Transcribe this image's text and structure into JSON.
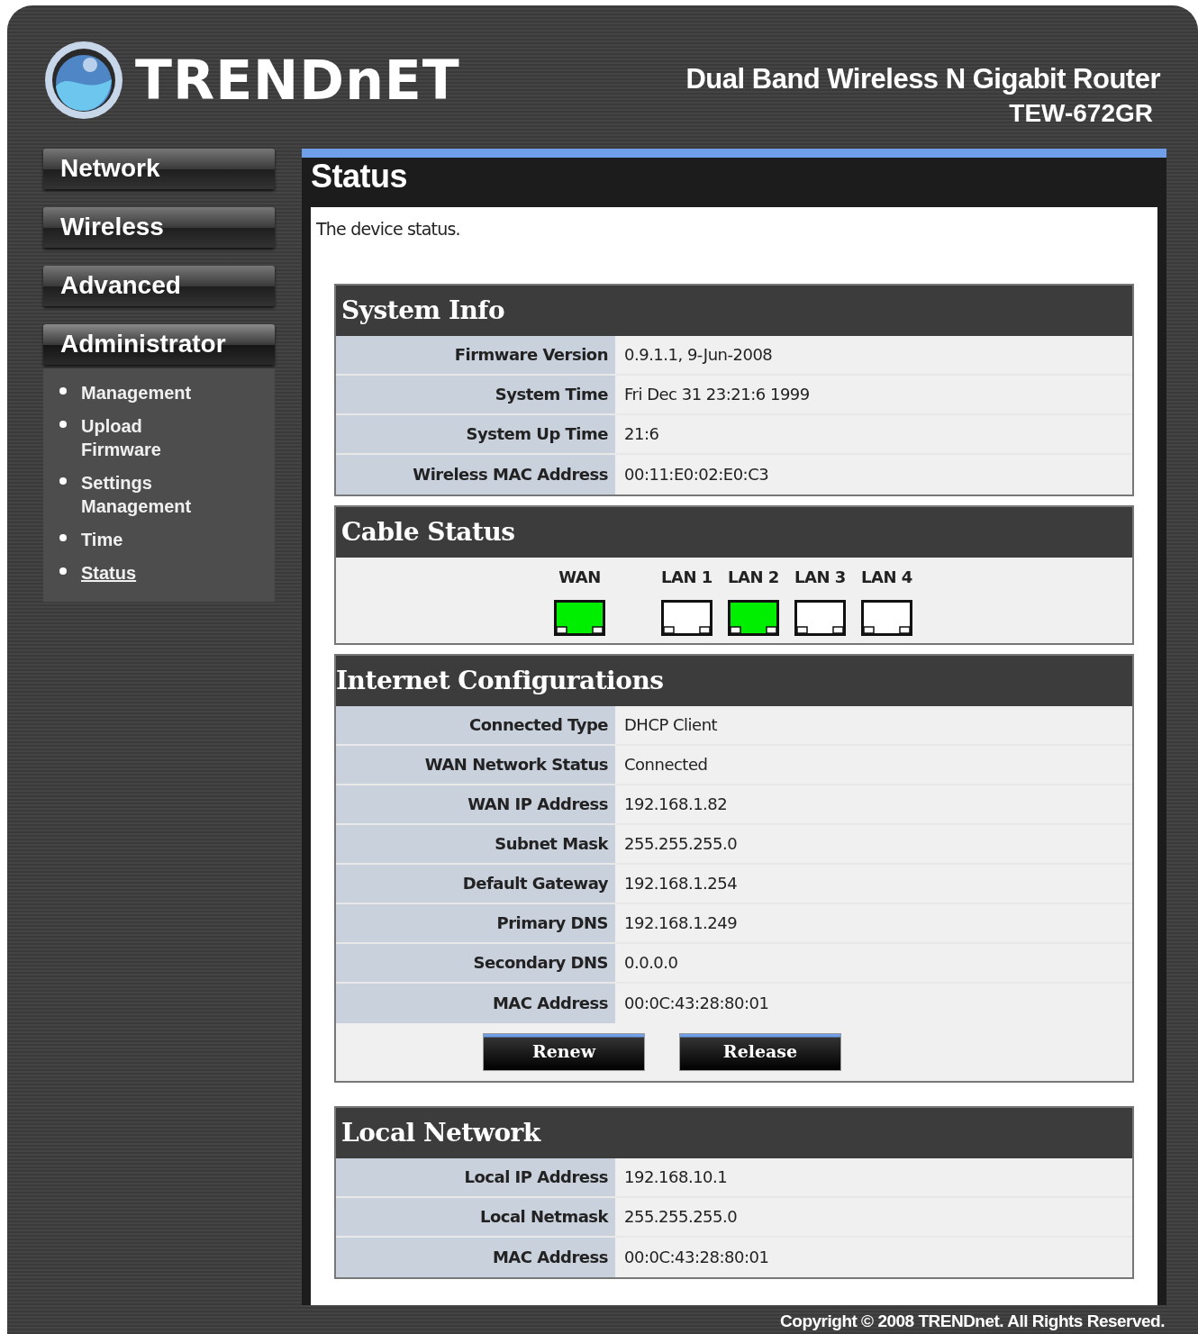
{
  "header": {
    "logo": "TRENDnET",
    "product": "Dual Band Wireless N Gigabit Router",
    "model": "TEW-672GR"
  },
  "sidebar": {
    "menus": [
      {
        "label": "Network",
        "expanded": false
      },
      {
        "label": "Wireless",
        "expanded": false
      },
      {
        "label": "Advanced",
        "expanded": false
      },
      {
        "label": "Administrator",
        "expanded": true,
        "items": [
          {
            "label": "Management",
            "selected": false
          },
          {
            "label": "Upload Firmware",
            "selected": false
          },
          {
            "label": "Settings Management",
            "selected": false
          },
          {
            "label": "Time",
            "selected": false
          },
          {
            "label": "Status",
            "selected": true
          }
        ]
      }
    ]
  },
  "page": {
    "title": "Status",
    "description": "The device status."
  },
  "system_info": {
    "title": "System Info",
    "rows": [
      {
        "label": "Firmware Version",
        "value": "0.9.1.1, 9-Jun-2008"
      },
      {
        "label": "System Time",
        "value": "Fri Dec 31 23:21:6 1999"
      },
      {
        "label": "System Up Time",
        "value": "21:6"
      },
      {
        "label": "Wireless MAC Address",
        "value": "00:11:E0:02:E0:C3"
      }
    ]
  },
  "cable_status": {
    "title": "Cable Status",
    "ports": [
      {
        "label": "WAN",
        "connected": true
      },
      {
        "label": "LAN 1",
        "connected": false
      },
      {
        "label": "LAN 2",
        "connected": true
      },
      {
        "label": "LAN 3",
        "connected": false
      },
      {
        "label": "LAN 4",
        "connected": false
      }
    ]
  },
  "internet_config": {
    "title": "Internet Configurations",
    "rows": [
      {
        "label": "Connected Type",
        "value": "DHCP Client"
      },
      {
        "label": "WAN Network Status",
        "value": "Connected"
      },
      {
        "label": "WAN IP Address",
        "value": "192.168.1.82"
      },
      {
        "label": "Subnet Mask",
        "value": "255.255.255.0"
      },
      {
        "label": "Default Gateway",
        "value": "192.168.1.254"
      },
      {
        "label": "Primary DNS",
        "value": "192.168.1.249"
      },
      {
        "label": "Secondary DNS",
        "value": "0.0.0.0"
      },
      {
        "label": "MAC Address",
        "value": "00:0C:43:28:80:01"
      }
    ],
    "buttons": [
      "Renew",
      "Release"
    ]
  },
  "local_network": {
    "title": "Local Network",
    "rows": [
      {
        "label": "Local IP Address",
        "value": "192.168.10.1"
      },
      {
        "label": "Local Netmask",
        "value": "255.255.255.0"
      },
      {
        "label": "MAC Address",
        "value": "00:0C:43:28:80:01"
      }
    ]
  },
  "footer": {
    "copyright": "Copyright © 2008 TRENDnet. All Rights Reserved."
  }
}
